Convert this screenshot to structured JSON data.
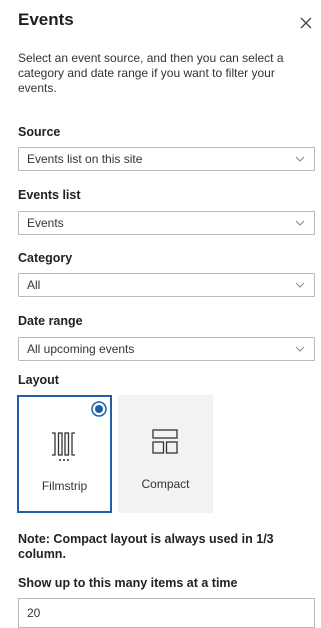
{
  "panel": {
    "title": "Events",
    "description": "Select an event source, and then you can select a category and date range if you want to filter your events."
  },
  "source": {
    "label": "Source",
    "value": "Events list on this site"
  },
  "events_list": {
    "label": "Events list",
    "value": "Events"
  },
  "category": {
    "label": "Category",
    "value": "All"
  },
  "date_range": {
    "label": "Date range",
    "value": "All upcoming events"
  },
  "layout": {
    "label": "Layout",
    "options": [
      {
        "label": "Filmstrip",
        "icon": "filmstrip-icon",
        "selected": true
      },
      {
        "label": "Compact",
        "icon": "compact-icon",
        "selected": false
      }
    ]
  },
  "note": "Note: Compact layout is always used in 1/3 column.",
  "items_count": {
    "label": "Show up to this many items at a time",
    "value": "20"
  },
  "colors": {
    "accent": "#1e5fa9",
    "border": "#b9b9b9",
    "option_bg": "#f3f2f1"
  }
}
